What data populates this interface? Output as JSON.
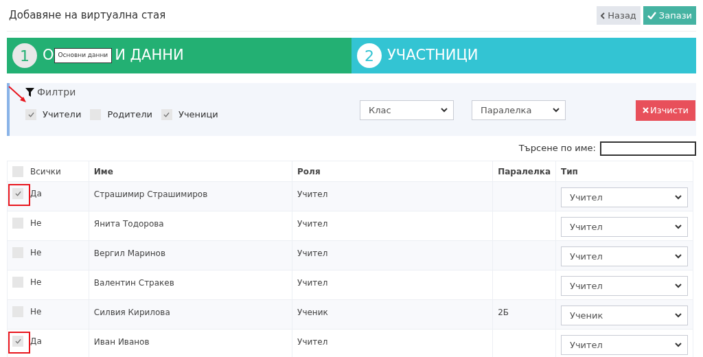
{
  "page": {
    "title": "Добавяне на виртуална стая"
  },
  "buttons": [
    {
      "kind": "back",
      "label": "Назад"
    },
    {
      "kind": "save",
      "label": "Запази"
    }
  ],
  "steps": [
    {
      "number": "1",
      "label_parts": [
        "О",
        "И ДАННИ"
      ],
      "tooltip": "Основни данни",
      "selected": false
    },
    {
      "number": "2",
      "label_parts": [
        "УЧАСТНИЦИ"
      ],
      "selected": true
    }
  ],
  "filters": {
    "title": "Филтри",
    "roles": [
      {
        "label": "Учители",
        "checked": true,
        "highlighted": true
      },
      {
        "label": "Родители",
        "checked": false,
        "highlighted": false
      },
      {
        "label": "Ученици",
        "checked": true,
        "highlighted": false
      }
    ],
    "selects": [
      "Клас",
      "Паралелка"
    ],
    "clear_button": "Изчисти"
  },
  "search": {
    "label": "Търсене по име:"
  },
  "table": {
    "columns": [
      "Всички",
      "Име",
      "Роля",
      "Паралелка",
      "Тип"
    ],
    "all_checked": false,
    "rows": [
      {
        "checked": true,
        "highlighted": true,
        "included": "Да",
        "name": "Страшимир Страшимиров",
        "role": "Учител",
        "class": "",
        "type": "Учител"
      },
      {
        "checked": false,
        "highlighted": false,
        "included": "Не",
        "name": "Янита Тодорова",
        "role": "Учител",
        "class": "",
        "type": "Учител"
      },
      {
        "checked": false,
        "highlighted": false,
        "included": "Не",
        "name": "Вергил Маринов",
        "role": "Учител",
        "class": "",
        "type": "Учител"
      },
      {
        "checked": false,
        "highlighted": false,
        "included": "Не",
        "name": "Валентин Стракев",
        "role": "Учител",
        "class": "",
        "type": "Учител"
      },
      {
        "checked": false,
        "highlighted": false,
        "included": "Не",
        "name": "Силвия Кирилова",
        "role": "Ученик",
        "class": "2Б",
        "type": "Ученик"
      },
      {
        "checked": true,
        "highlighted": true,
        "included": "Да",
        "name": "Иван Иванов",
        "role": "Учител",
        "class": "",
        "type": "Учител"
      }
    ]
  }
}
